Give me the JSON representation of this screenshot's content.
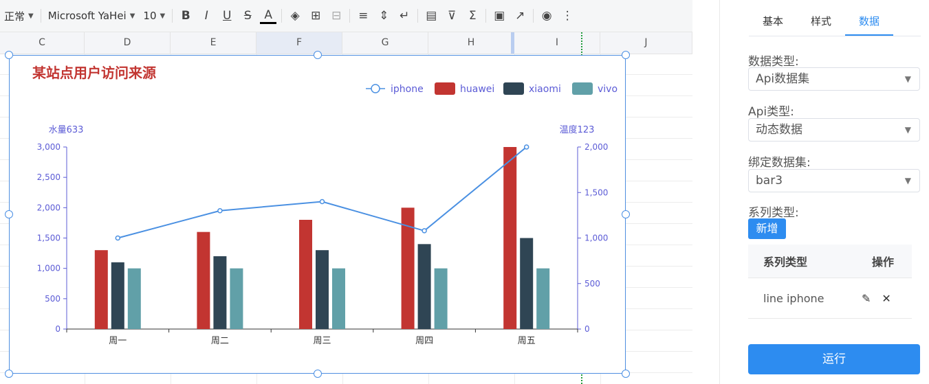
{
  "toolbar": {
    "style_select": "正常",
    "font_select": "Microsoft YaHei",
    "size_select": "10"
  },
  "columns": [
    "C",
    "D",
    "E",
    "F",
    "G",
    "H",
    "I",
    "J"
  ],
  "panel": {
    "tabs": [
      "基本",
      "样式",
      "数据"
    ],
    "active_tab": "数据",
    "data_type_label": "数据类型:",
    "data_type_value": "Api数据集",
    "api_type_label": "Api类型:",
    "api_type_value": "动态数据",
    "dataset_label": "绑定数据集:",
    "dataset_value": "bar3",
    "series_type_label": "系列类型:",
    "add_button": "新增",
    "table": {
      "headers": [
        "系列类型",
        "操作"
      ],
      "rows": [
        {
          "series": "line iphone"
        }
      ]
    },
    "run_button": "运行"
  },
  "chart_data": {
    "type": "bar",
    "title": "某站点用户访问来源",
    "categories": [
      "周一",
      "周二",
      "周三",
      "周四",
      "周五"
    ],
    "ylabel_left": "水量633",
    "ylabel_right": "温度123",
    "ylim_left": [
      0,
      3000
    ],
    "yticks_left": [
      "0",
      "500",
      "1,000",
      "1,500",
      "2,000",
      "2,500",
      "3,000"
    ],
    "ylim_right": [
      0,
      2000
    ],
    "yticks_right": [
      "0",
      "500",
      "1,000",
      "1,500",
      "2,000"
    ],
    "legend_position": "top-right",
    "series": [
      {
        "name": "iphone",
        "type": "line",
        "axis": "right",
        "color": "#4a90e2",
        "values": [
          1000,
          1300,
          1400,
          1080,
          2000
        ]
      },
      {
        "name": "huawei",
        "type": "bar",
        "axis": "left",
        "color": "#c23531",
        "values": [
          1300,
          1600,
          1800,
          2000,
          3000
        ]
      },
      {
        "name": "xiaomi",
        "type": "bar",
        "axis": "left",
        "color": "#2f4554",
        "values": [
          1100,
          1200,
          1300,
          1400,
          1500
        ]
      },
      {
        "name": "vivo",
        "type": "bar",
        "axis": "left",
        "color": "#61a0a8",
        "values": [
          1000,
          1000,
          1000,
          1000,
          1000
        ]
      }
    ]
  }
}
